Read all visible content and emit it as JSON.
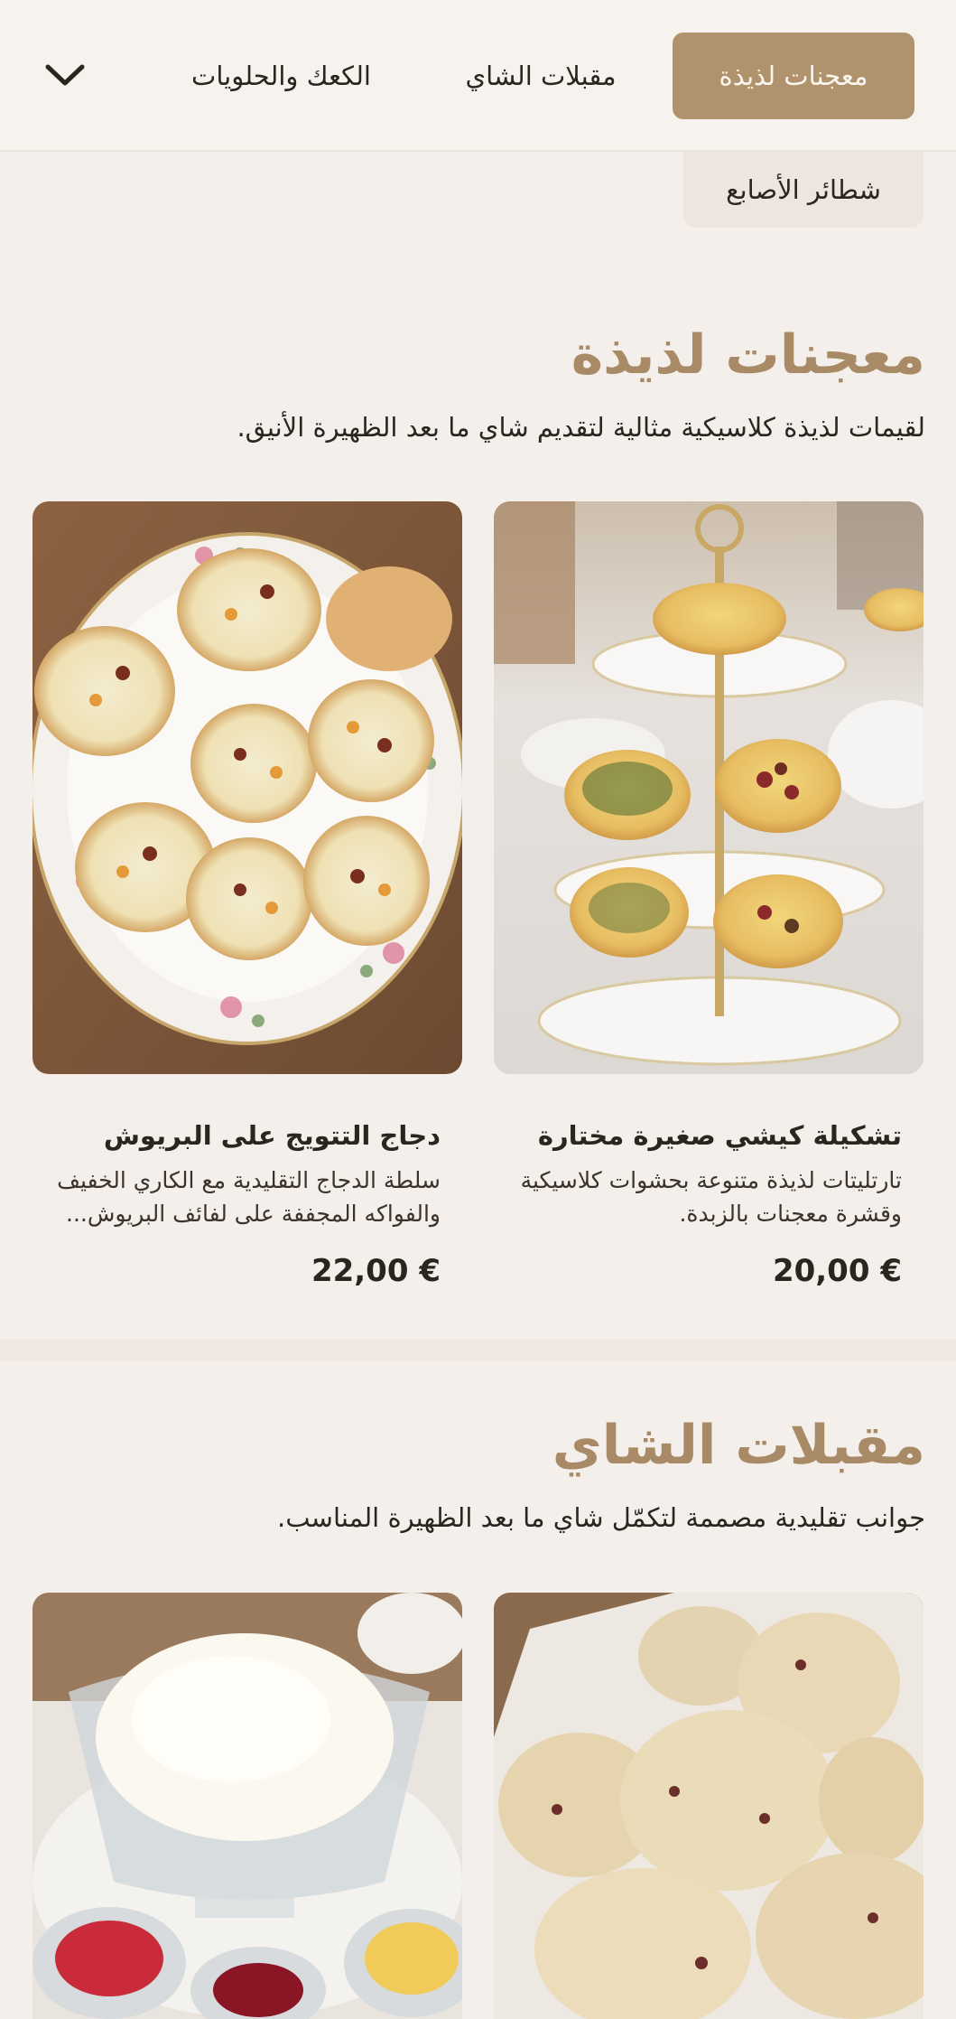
{
  "nav": {
    "tabs": [
      {
        "label": "معجنات لذيذة",
        "active": true
      },
      {
        "label": "مقبلات الشاي",
        "active": false
      },
      {
        "label": "الكعك والحلويات",
        "active": false
      },
      {
        "label": "شطائر الأصابع",
        "active": false
      }
    ],
    "more_icon": "chevron-down-icon"
  },
  "sections": [
    {
      "title": "معجنات لذيذة",
      "subtitle": "لقيمات لذيذة كلاسيكية مثالية لتقديم شاي ما بعد الظهيرة الأنيق.",
      "items": [
        {
          "name": "تشكيلة كيشي صغيرة مختارة",
          "description_line1": "تارتليتات لذيذة متنوعة بحشوات كلاسيكية",
          "description_line2": "وقشرة معجنات بالزبدة.",
          "price": "20,00 €",
          "image": "mini-quiche-tiered-stand-photo"
        },
        {
          "name": "دجاج التتويج على البريوش",
          "description_line1": "سلطة الدجاج التقليدية مع الكاري الخفيف",
          "description_line2": "والفواكه المجففة على لفائف البريوش...",
          "price": "22,00 €",
          "image": "coronation-chicken-brioche-photo"
        }
      ]
    },
    {
      "title": "مقبلات الشاي",
      "subtitle": "جوانب تقليدية مصممة لتكمّل شاي ما بعد الظهيرة المناسب.",
      "items": [
        {
          "image": "scones-basket-photo"
        },
        {
          "image": "clotted-cream-and-jams-photo"
        }
      ]
    }
  ],
  "colors": {
    "background": "#f4efeb",
    "accent": "#b0926c",
    "title": "#a88a66",
    "text": "#2b2520"
  }
}
